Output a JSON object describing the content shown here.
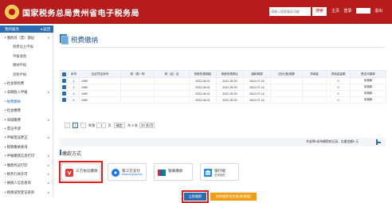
{
  "header": {
    "site_title": "国家税务总局贵州省电子税务局",
    "search_placeholder": "请输入搜索服务功能",
    "search_label": "搜索",
    "links": [
      "主页",
      "登录"
    ],
    "logout_label": "退出"
  },
  "sidebar": {
    "top_label": "我的服务",
    "back_label": "◂ 返回",
    "items": [
      {
        "label": "• 我的待（票）期设",
        "sub": false,
        "chev": "▾"
      },
      {
        "label": "税费设立申报",
        "sub": true,
        "chev": ""
      },
      {
        "label": "申报收款",
        "sub": true,
        "chev": ""
      },
      {
        "label": "缴纳申报",
        "sub": true,
        "chev": ""
      },
      {
        "label": "退税申报",
        "sub": true,
        "chev": ""
      },
      {
        "label": "• 社会保险费",
        "sub": false,
        "chev": ""
      },
      {
        "label": "• 非税收入申报",
        "sub": false,
        "chev": "▸"
      },
      {
        "label": "• 税费缴纳",
        "sub": false,
        "chev": "",
        "active": true
      },
      {
        "label": "• 社会缴费",
        "sub": false,
        "chev": ""
      },
      {
        "label": "• 同城缴费",
        "sub": false,
        "chev": "▸"
      },
      {
        "label": "• 票证申请",
        "sub": false,
        "chev": ""
      },
      {
        "label": "• 申报错误更正",
        "sub": false,
        "chev": "▸"
      },
      {
        "label": "• 税款缴纳查询",
        "sub": false,
        "chev": ""
      },
      {
        "label": "• 申报缴款信息打印",
        "sub": false,
        "chev": "▸"
      },
      {
        "label": "• 缴款凭证打印",
        "sub": false,
        "chev": "▸"
      },
      {
        "label": "• 税务行政许可",
        "sub": false,
        "chev": "▸"
      },
      {
        "label": "• 纳税人信息查询",
        "sub": false,
        "chev": "▸"
      },
      {
        "label": "• 税收减免登记查询",
        "sub": false,
        "chev": "▸"
      }
    ]
  },
  "main": {
    "page_title": "税费缴纳",
    "table": {
      "headers": [
        "",
        "序号",
        "应征凭证序号",
        "税（费）种",
        "税（品）目",
        "税款所属期起",
        "税款所属期止",
        "缴款期限",
        "应补(退)税额",
        "滞纳金",
        "滞纳金金额",
        "是否可缴款"
      ],
      "rows": [
        {
          "no": "1",
          "voucher": "1080",
          "tax": "",
          "item": "",
          "start": "2022-06-01",
          "end": "2022-06-30",
          "due": "2022-07-15",
          "amount": "",
          "late": "",
          "late_amt": "0",
          "status": "未缴款"
        },
        {
          "no": "2",
          "voucher": "1080",
          "tax": "",
          "item": "",
          "start": "2022-06-01",
          "end": "2022-06-30",
          "due": "2022-07-15",
          "amount": "",
          "late": "",
          "late_amt": "0",
          "status": "未缴款"
        },
        {
          "no": "3",
          "voucher": "1080",
          "tax": "",
          "item": "",
          "start": "2022-06-01",
          "end": "2022-06-30",
          "due": "2022-07-15",
          "amount": "",
          "late": "",
          "late_amt": "0",
          "status": "未缴款"
        },
        {
          "no": "4",
          "voucher": "1080",
          "tax": "",
          "item": "",
          "start": "2022-06-01",
          "end": "2022-06-30",
          "due": "2022-07-15",
          "amount": "",
          "late": "",
          "late_amt": "0",
          "status": "未缴款"
        }
      ]
    },
    "pager": {
      "prev": "‹",
      "current": "1",
      "next": "›",
      "goto_prefix": "到第",
      "goto_value": "1",
      "goto_suffix": "页",
      "jump_label": "确定",
      "total": "共 4 条",
      "page_size": "20 条/页"
    },
    "summary": {
      "text": "共选择4条待缴税款记录，实缴金额",
      "value": "0",
      "currency": "元"
    },
    "pay_method_title": "缴款方式",
    "pay_methods": [
      {
        "label": "三方协议缴款",
        "sub": ""
      },
      {
        "label": "第三方支付",
        "sub": "www.xxxpay.com"
      },
      {
        "label": "银联缴款",
        "sub": ""
      },
      {
        "label": "银行端",
        "sub": "查询缴税"
      }
    ],
    "buttons": {
      "confirm": "立即缴款",
      "back": "申报缴款信息查询(缴款)"
    }
  }
}
